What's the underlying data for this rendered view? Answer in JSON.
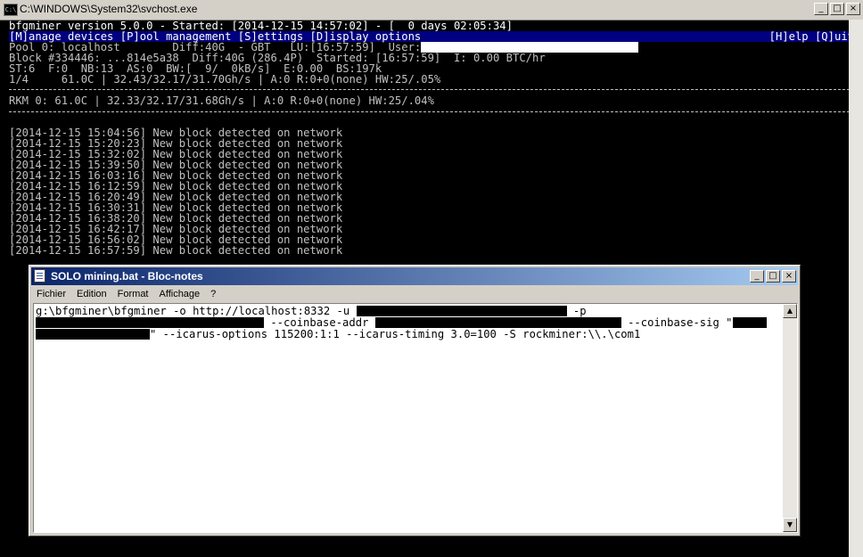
{
  "console": {
    "title": "C:\\WINDOWS\\System32\\svchost.exe",
    "icon_label": "C:\\",
    "header_line": "bfgminer version 5.0.0 - Started: [2014-12-15 14:57:02] - [  0 days 02:05:34]",
    "menu_left": "[M]anage devices [P]ool management [S]ettings [D]isplay options",
    "menu_right": "[H]elp [Q]uit",
    "pool_line": "Pool 0: localhost        Diff:40G  - GBT   LU:[16:57:59]  User:",
    "block_line": "Block #334446: ...814e5a38  Diff:40G (286.4P)  Started: [16:57:59]  I: 0.00 BTC/hr",
    "stats_line": "ST:6  F:0  NB:13  AS:0  BW:[  9/  0kB/s]  E:0.00  BS:197k",
    "summary_line": "1/4     61.0C | 32.43/32.17/31.70Gh/s | A:0 R:0+0(none) HW:25/.05%",
    "device_line": "RKM 0: 61.0C | 32.33/32.17/31.68Gh/s | A:0 R:0+0(none) HW:25/.04%",
    "log": [
      "[2014-12-15 15:04:56] New block detected on network",
      "[2014-12-15 15:20:23] New block detected on network",
      "[2014-12-15 15:32:02] New block detected on network",
      "[2014-12-15 15:39:50] New block detected on network",
      "[2014-12-15 16:03:16] New block detected on network",
      "[2014-12-15 16:12:59] New block detected on network",
      "[2014-12-15 16:20:49] New block detected on network",
      "[2014-12-15 16:30:31] New block detected on network",
      "[2014-12-15 16:38:20] New block detected on network",
      "[2014-12-15 16:42:17] New block detected on network",
      "[2014-12-15 16:56:02] New block detected on network",
      "[2014-12-15 16:57:59] New block detected on network"
    ],
    "buttons": {
      "minimize": "_",
      "maximize": "□",
      "close": "×"
    }
  },
  "notepad": {
    "title": "SOLO mining.bat - Bloc-notes",
    "menu": [
      "Fichier",
      "Edition",
      "Format",
      "Affichage",
      "?"
    ],
    "line1_a": "g:\\bfgminer\\bfgminer -o http://localhost:8332 -u",
    "line1_b": "-p",
    "line2_a": "--coinbase-addr",
    "line2_b": "--coinbase-sig \"",
    "line3_a": "\" --icarus-options 115200:1:1 --icarus-timing 3.0=100 -S rockminer:\\\\.\\com1",
    "buttons": {
      "minimize": "_",
      "maximize": "□",
      "close": "×"
    },
    "scroll_up": "▲",
    "scroll_down": "▼"
  }
}
